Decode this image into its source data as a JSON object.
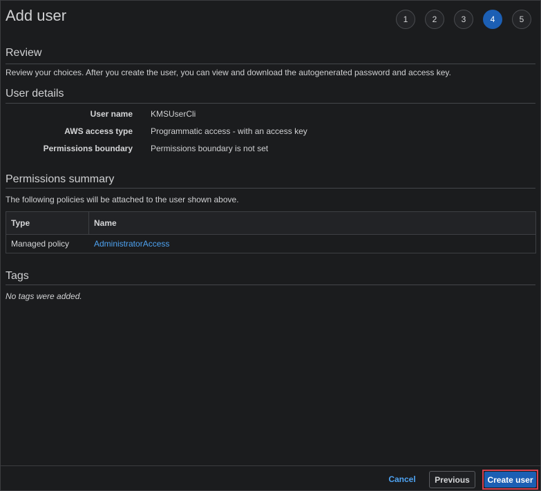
{
  "header": {
    "title": "Add user"
  },
  "steps": [
    "1",
    "2",
    "3",
    "4",
    "5"
  ],
  "active_step": "4",
  "review": {
    "heading": "Review",
    "description": "Review your choices. After you create the user, you can view and download the autogenerated password and access key."
  },
  "user_details": {
    "heading": "User details",
    "rows": [
      {
        "label": "User name",
        "value": "KMSUserCli"
      },
      {
        "label": "AWS access type",
        "value": "Programmatic access - with an access key"
      },
      {
        "label": "Permissions boundary",
        "value": "Permissions boundary is not set"
      }
    ]
  },
  "permissions": {
    "heading": "Permissions summary",
    "description": "The following policies will be attached to the user shown above.",
    "columns": [
      "Type",
      "Name"
    ],
    "rows": [
      {
        "type": "Managed policy",
        "name": "AdministratorAccess"
      }
    ]
  },
  "tags": {
    "heading": "Tags",
    "empty_text": "No tags were added."
  },
  "footer": {
    "cancel": "Cancel",
    "previous": "Previous",
    "create": "Create user"
  },
  "colors": {
    "accent": "#1c5fb4",
    "link": "#4ea3f2",
    "highlight": "#d7404f",
    "background": "#1b1c1e"
  }
}
